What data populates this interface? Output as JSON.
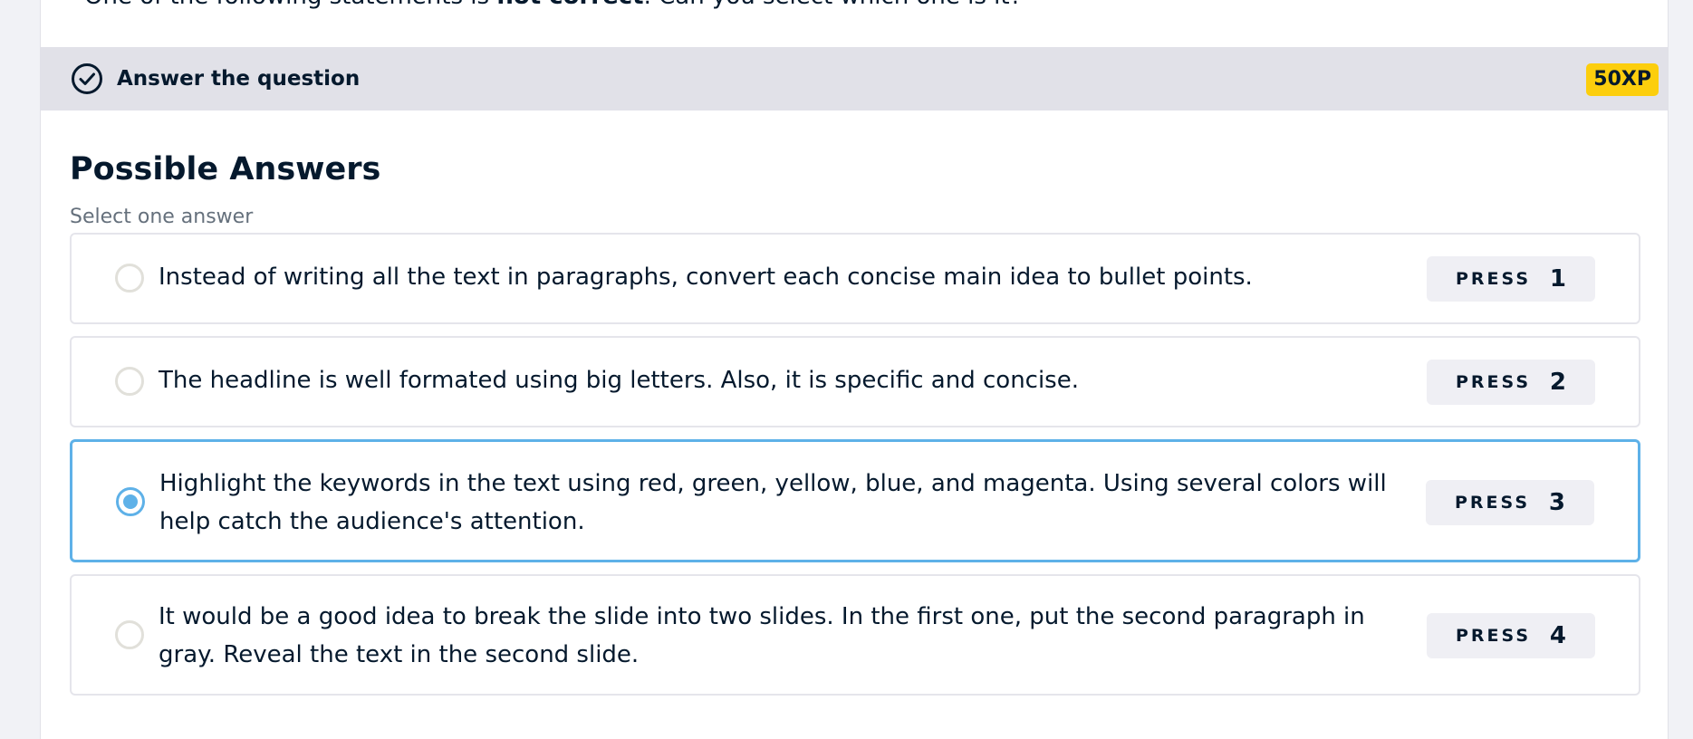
{
  "question": {
    "prefix": "One of the following statements is ",
    "emphasis": "not correct",
    "suffix": ". Can you select which one is it?"
  },
  "task_bar": {
    "title": "Answer the question",
    "xp": "50XP",
    "icon": "check-circle-icon"
  },
  "answers": {
    "heading": "Possible Answers",
    "hint": "Select one answer",
    "press_label": "PRESS",
    "options": [
      {
        "text": "Instead of writing all the text in paragraphs, convert each concise main idea to bullet points.",
        "key": "1",
        "selected": false
      },
      {
        "text": "The headline is well formated using big letters. Also, it is specific and concise.",
        "key": "2",
        "selected": false
      },
      {
        "text": "Highlight the keywords in the text using red, green, yellow, blue, and magenta. Using several colors will help catch the audience's attention.",
        "key": "3",
        "selected": true
      },
      {
        "text": "It would be a good idea to break the slide into two slides. In the first one, put the second paragraph in gray. Reveal the text in the second slide.",
        "key": "4",
        "selected": false
      }
    ]
  },
  "colors": {
    "accent": "#5eb1e8",
    "xp_badge": "#fcce0d",
    "bar_background": "#e1e1e8",
    "text": "#05192d"
  }
}
